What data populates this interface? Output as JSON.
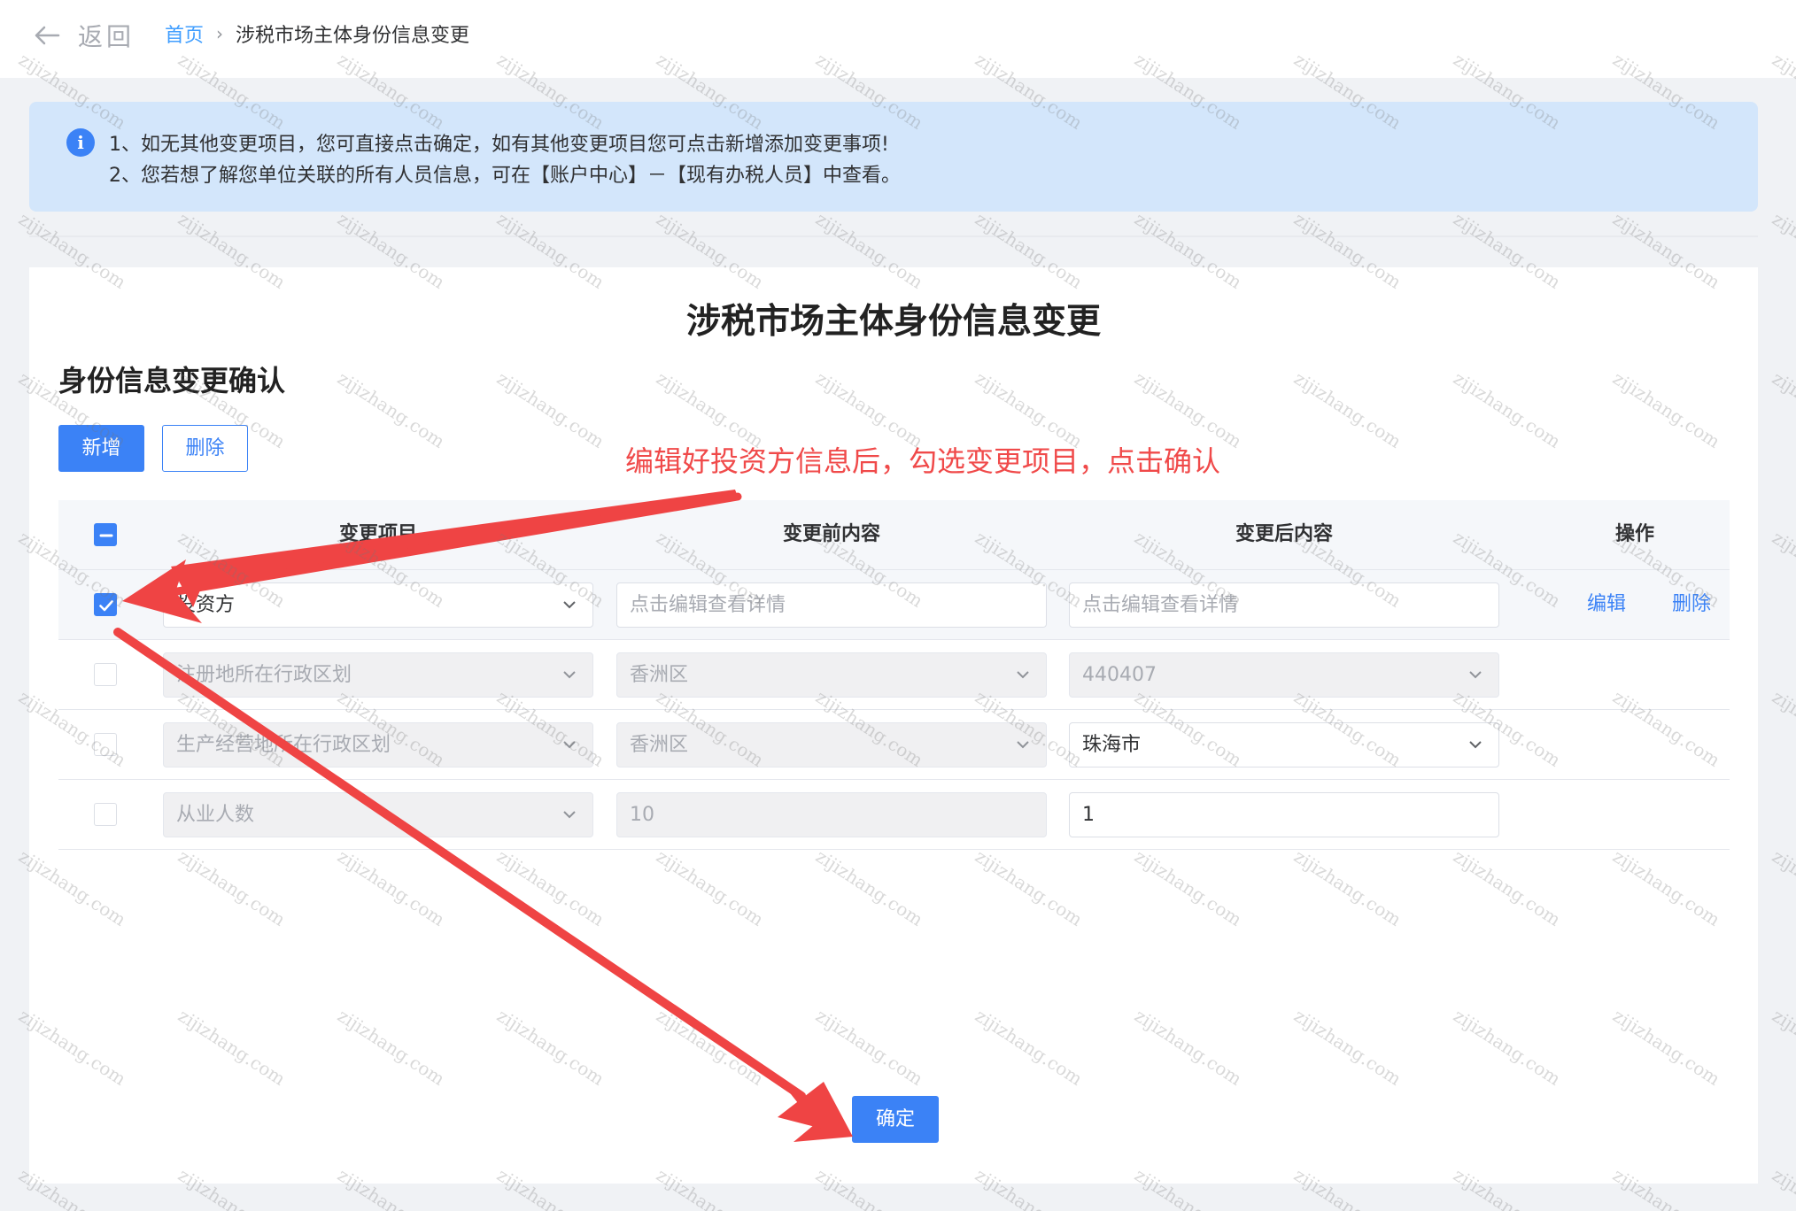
{
  "nav": {
    "back_label": "返回",
    "breadcrumb": {
      "home": "首页",
      "separator": "›",
      "current": "涉税市场主体身份信息变更"
    }
  },
  "notice": {
    "icon": "info-icon",
    "line1": "1、如无其他变更项目，您可直接点击确定，如有其他变更项目您可点击新增添加变更事项!",
    "line2": "2、您若想了解您单位关联的所有人员信息，可在【账户中心】－【现有办税人员】中查看。"
  },
  "page": {
    "title": "涉税市场主体身份信息变更",
    "subtitle": "身份信息变更确认",
    "add_label": "新增",
    "delete_label": "删除",
    "confirm_label": "确定"
  },
  "table": {
    "headers": {
      "item": "变更项目",
      "before": "变更前内容",
      "after": "变更后内容",
      "actions": "操作"
    },
    "rows": [
      {
        "checked": true,
        "item": "投资方",
        "before": "点击编辑查看详情",
        "after": "点击编辑查看详情",
        "edit": "编辑",
        "delete": "删除"
      },
      {
        "checked": false,
        "item": "注册地所在行政区划",
        "before": "香洲区",
        "after": "440407"
      },
      {
        "checked": false,
        "item": "生产经营地所在行政区划",
        "before": "香洲区",
        "after": "珠海市"
      },
      {
        "checked": false,
        "item": "从业人数",
        "before": "10",
        "after": "1"
      }
    ]
  },
  "annotation": {
    "text": "编辑好投资方信息后，勾选变更项目，点击确认",
    "color": "#f04a4a"
  },
  "watermark": {
    "text": "zijizhang.com"
  },
  "colors": {
    "primary": "#3b82f6",
    "notice_bg": "#d3e6fb",
    "arrow": "#ef4444"
  }
}
